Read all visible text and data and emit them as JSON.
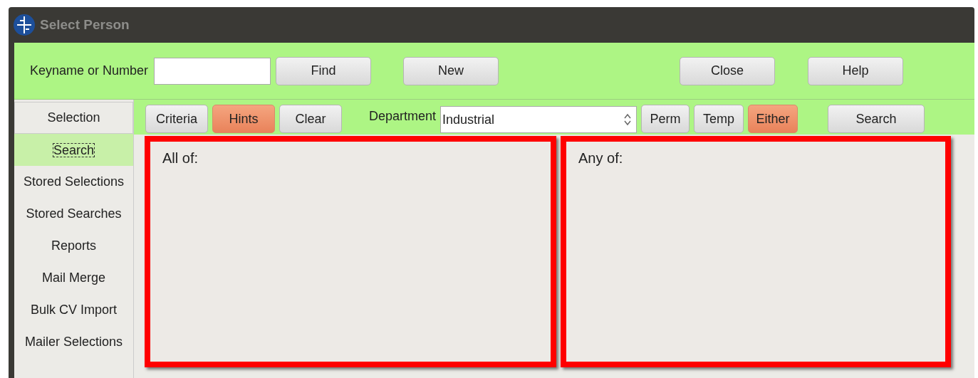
{
  "window": {
    "title": "Select Person"
  },
  "toolbar": {
    "label": "Keyname or Number",
    "buttons": [
      "Find",
      "New",
      "Close",
      "Help"
    ]
  },
  "sidebar": {
    "header": "Selection",
    "items": [
      {
        "label": "Search",
        "selected": true
      },
      {
        "label": "Stored Selections",
        "selected": false
      },
      {
        "label": "Stored Searches",
        "selected": false
      },
      {
        "label": "Reports",
        "selected": false
      },
      {
        "label": "Mail Merge",
        "selected": false
      },
      {
        "label": "Bulk CV Import",
        "selected": false
      },
      {
        "label": "Mailer Selections",
        "selected": false
      }
    ]
  },
  "search_bar": {
    "mode_buttons": [
      {
        "label": "Criteria",
        "selected": false
      },
      {
        "label": "Hints",
        "selected": true
      },
      {
        "label": "Clear",
        "selected": false
      }
    ],
    "department": {
      "label": "Department",
      "value": "Industrial"
    },
    "type_buttons": [
      {
        "label": "Perm",
        "selected": false
      },
      {
        "label": "Temp",
        "selected": false
      },
      {
        "label": "Either",
        "selected": true
      }
    ],
    "search_button": "Search"
  },
  "panels": [
    {
      "heading": "All of:"
    },
    {
      "heading": "Any of:"
    }
  ]
}
